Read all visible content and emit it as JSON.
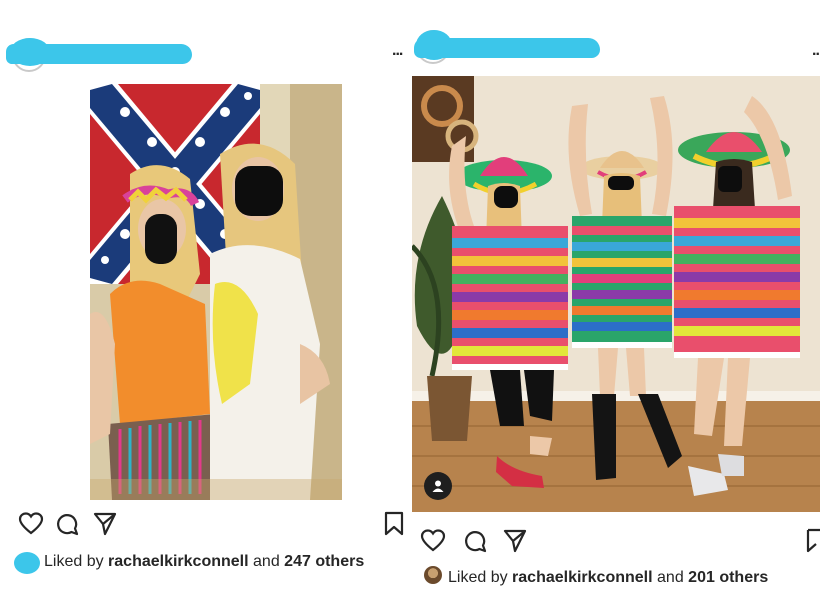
{
  "colors": {
    "redaction": "#3cc6ea",
    "text": "#262626"
  },
  "left_post": {
    "username": "",
    "more_icon": "",
    "image_description_icon": "person-tag-icon",
    "actions": [
      "heart-icon",
      "comment-icon",
      "share-icon",
      "bookmark-icon"
    ],
    "likes": {
      "prefix": "Liked by",
      "user": "rachaelkirkconnell",
      "middle": "and",
      "count": "247 others"
    }
  },
  "right_post": {
    "username": "",
    "more_icon": "...",
    "image_description_icon": "person-tag-icon",
    "actions": [
      "heart-icon",
      "comment-icon",
      "share-icon",
      "bookmark-icon"
    ],
    "likes": {
      "prefix": "Liked by",
      "user": "rachaelkirkconnell",
      "middle": "and",
      "count": "201 others"
    }
  }
}
